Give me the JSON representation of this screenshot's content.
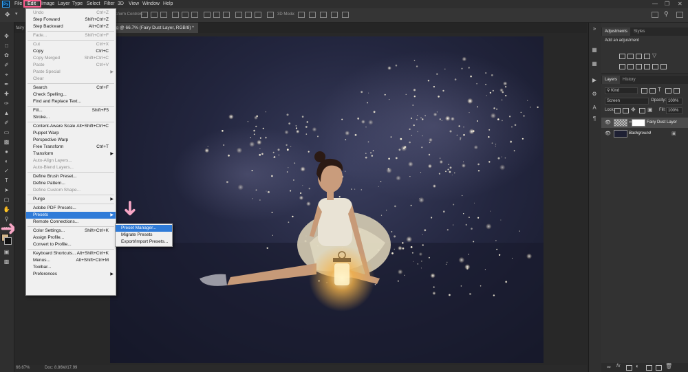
{
  "menubar": {
    "items": [
      "File",
      "Edit",
      "Image",
      "Layer",
      "Type",
      "Select",
      "Filter",
      "3D",
      "View",
      "Window",
      "Help"
    ],
    "active": "Edit"
  },
  "optionsbar": {
    "show_controls": "w Transform Controls",
    "mode_3d": "3D Mode:"
  },
  "document": {
    "tab_left": "fairy",
    "tab_title": "n.png @ 66.7% (Fairy Dust Layer, RGB/8) *",
    "zoom": "66.67%",
    "doc_size": "Doc: 8.86M/17.99"
  },
  "edit_menu": [
    {
      "label": "Undo",
      "shortcut": "Ctrl+Z",
      "disabled": true
    },
    {
      "label": "Step Forward",
      "shortcut": "Shift+Ctrl+Z"
    },
    {
      "label": "Step Backward",
      "shortcut": "Alt+Ctrl+Z"
    },
    {
      "sep": true
    },
    {
      "label": "Fade...",
      "shortcut": "Shift+Ctrl+F",
      "disabled": true
    },
    {
      "sep": true
    },
    {
      "label": "Cut",
      "shortcut": "Ctrl+X",
      "disabled": true
    },
    {
      "label": "Copy",
      "shortcut": "Ctrl+C"
    },
    {
      "label": "Copy Merged",
      "shortcut": "Shift+Ctrl+C",
      "disabled": true
    },
    {
      "label": "Paste",
      "shortcut": "Ctrl+V",
      "disabled": true
    },
    {
      "label": "Paste Special",
      "submenu": true,
      "disabled": true
    },
    {
      "label": "Clear",
      "disabled": true
    },
    {
      "sep": true
    },
    {
      "label": "Search",
      "shortcut": "Ctrl+F"
    },
    {
      "label": "Check Spelling..."
    },
    {
      "label": "Find and Replace Text..."
    },
    {
      "sep": true
    },
    {
      "label": "Fill...",
      "shortcut": "Shift+F5"
    },
    {
      "label": "Stroke..."
    },
    {
      "sep": true
    },
    {
      "label": "Content-Aware Scale",
      "shortcut": "Alt+Shift+Ctrl+C"
    },
    {
      "label": "Puppet Warp"
    },
    {
      "label": "Perspective Warp"
    },
    {
      "label": "Free Transform",
      "shortcut": "Ctrl+T"
    },
    {
      "label": "Transform",
      "submenu": true
    },
    {
      "label": "Auto-Align Layers...",
      "disabled": true
    },
    {
      "label": "Auto-Blend Layers...",
      "disabled": true
    },
    {
      "sep": true
    },
    {
      "label": "Define Brush Preset..."
    },
    {
      "label": "Define Pattern..."
    },
    {
      "label": "Define Custom Shape...",
      "disabled": true
    },
    {
      "sep": true
    },
    {
      "label": "Purge",
      "submenu": true
    },
    {
      "sep": true
    },
    {
      "label": "Adobe PDF Presets..."
    },
    {
      "label": "Presets",
      "submenu": true,
      "highlighted": true
    },
    {
      "label": "Remote Connections..."
    },
    {
      "sep": true
    },
    {
      "label": "Color Settings...",
      "shortcut": "Shift+Ctrl+K"
    },
    {
      "label": "Assign Profile..."
    },
    {
      "label": "Convert to Profile..."
    },
    {
      "sep": true
    },
    {
      "label": "Keyboard Shortcuts...",
      "shortcut": "Alt+Shift+Ctrl+K"
    },
    {
      "label": "Menus...",
      "shortcut": "Alt+Shift+Ctrl+M"
    },
    {
      "label": "Toolbar..."
    },
    {
      "label": "Preferences",
      "submenu": true
    }
  ],
  "presets_submenu": [
    {
      "label": "Preset Manager...",
      "highlighted": true
    },
    {
      "label": "Migrate Presets"
    },
    {
      "label": "Export/Import Presets..."
    }
  ],
  "adjustments_panel": {
    "tabs": [
      "Adjustments",
      "Styles"
    ],
    "heading": "Add an adjustment"
  },
  "layers_panel": {
    "tabs": [
      "Layers",
      "History"
    ],
    "filter": "Kind",
    "blend_mode": "Screen",
    "opacity_label": "Opacity:",
    "opacity": "100%",
    "lock_label": "Lock:",
    "fill_label": "Fill:",
    "fill": "100%",
    "layers": [
      {
        "name": "Fairy Dust Layer",
        "selected": true
      },
      {
        "name": "Background",
        "locked": true
      }
    ]
  },
  "colors": {
    "menu_highlight": "#2f7bd8",
    "annotation_pink": "#f7a6c5",
    "foreground": "#d3b68a",
    "background": "#101010"
  }
}
